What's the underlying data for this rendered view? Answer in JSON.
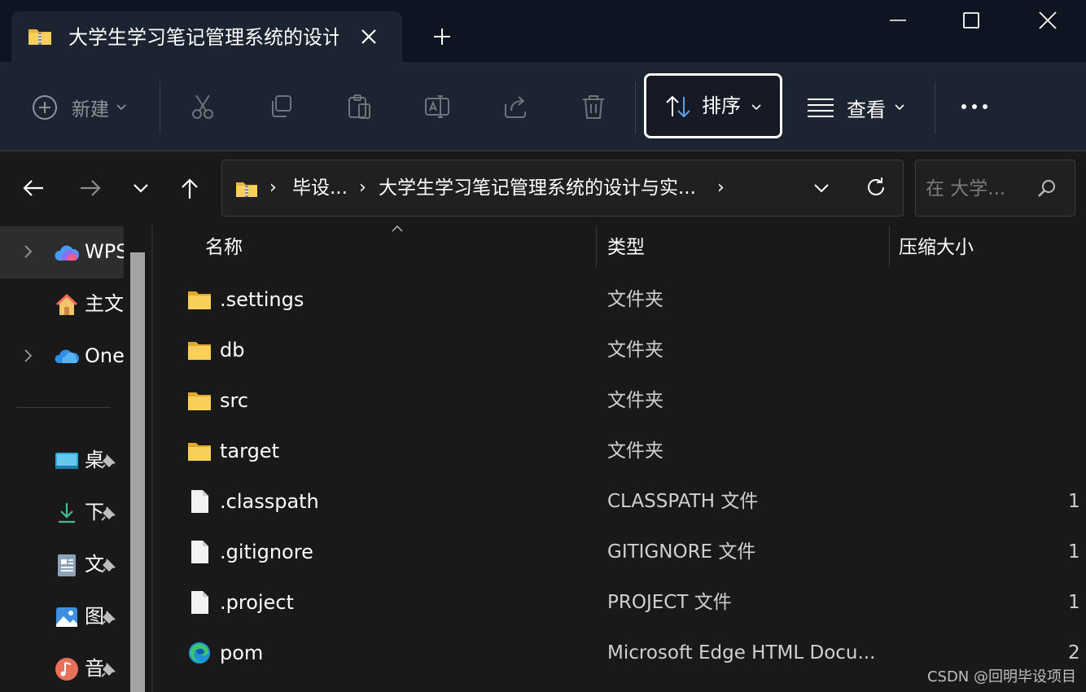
{
  "tab": {
    "title": "大学生学习笔记管理系统的设计"
  },
  "toolbar": {
    "new_label": "新建",
    "sort_label": "排序",
    "view_label": "查看"
  },
  "address": {
    "crumbs": [
      "毕设...",
      "大学生学习笔记管理系统的设计与实..."
    ]
  },
  "search": {
    "placeholder": "在 大学..."
  },
  "sidebar": {
    "items": [
      {
        "label": "WPS",
        "icon": "cloud-colorful-icon"
      },
      {
        "label": "主文",
        "icon": "home-icon"
      },
      {
        "label": "One",
        "icon": "onedrive-cloud-icon"
      }
    ],
    "quick_access": [
      {
        "label": "桌",
        "icon": "desktop-icon"
      },
      {
        "label": "下",
        "icon": "download-icon"
      },
      {
        "label": "文",
        "icon": "document-icon"
      },
      {
        "label": "图",
        "icon": "picture-icon"
      },
      {
        "label": "音",
        "icon": "music-icon"
      }
    ]
  },
  "columns": {
    "name": "名称",
    "type": "类型",
    "size": "压缩大小"
  },
  "files": [
    {
      "name": ".settings",
      "type": "文件夹",
      "size": "",
      "icon": "folder-icon"
    },
    {
      "name": "db",
      "type": "文件夹",
      "size": "",
      "icon": "folder-icon"
    },
    {
      "name": "src",
      "type": "文件夹",
      "size": "",
      "icon": "folder-icon"
    },
    {
      "name": "target",
      "type": "文件夹",
      "size": "",
      "icon": "folder-icon"
    },
    {
      "name": ".classpath",
      "type": "CLASSPATH 文件",
      "size": "1",
      "icon": "file-icon"
    },
    {
      "name": ".gitignore",
      "type": "GITIGNORE 文件",
      "size": "1",
      "icon": "file-icon"
    },
    {
      "name": ".project",
      "type": "PROJECT 文件",
      "size": "1",
      "icon": "file-icon"
    },
    {
      "name": "pom",
      "type": "Microsoft Edge HTML Docu...",
      "size": "2",
      "icon": "edge-icon"
    }
  ],
  "watermark": "CSDN @回明毕设项目",
  "colors": {
    "titlebar": "#0e1420",
    "commandbar": "#1c2331",
    "folder": "#f4c542",
    "background": "#191919"
  }
}
